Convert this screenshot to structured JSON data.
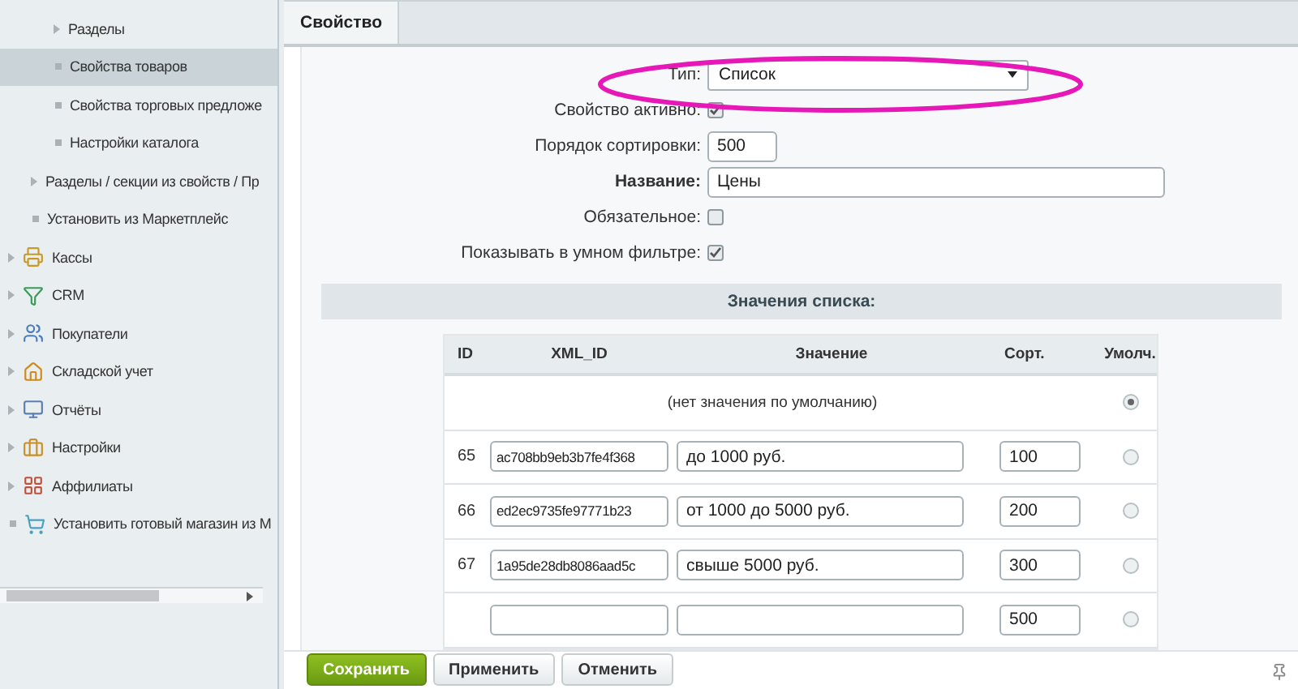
{
  "sidebar": {
    "items": [
      {
        "children": [
          {
            "children": [
              {
                "label": "Разделы",
                "kind": "arrow",
                "selected": false
              },
              {
                "label": "Свойства товаров",
                "kind": "dot",
                "selected": true
              },
              {
                "label": "Свойства торговых предложе",
                "kind": "dot",
                "selected": false
              },
              {
                "label": "Настройки каталога",
                "kind": "dot",
                "selected": false
              }
            ]
          },
          {
            "label": "Разделы / секции из свойств / Пр",
            "kind": "arrow",
            "selected": false
          },
          {
            "label": "Установить из Маркетплейс",
            "kind": "dot",
            "selected": false
          }
        ]
      },
      {
        "label": "Кассы",
        "kind": "arrow",
        "selected": false
      },
      {
        "label": "CRM",
        "kind": "arrow",
        "selected": false
      },
      {
        "label": "Покупатели",
        "kind": "arrow",
        "selected": false
      },
      {
        "label": "Складской учет",
        "kind": "arrow",
        "selected": false
      },
      {
        "label": "Отчёты",
        "kind": "arrow",
        "selected": false
      },
      {
        "label": "Настройки",
        "kind": "arrow",
        "selected": false
      },
      {
        "label": "Аффилиаты",
        "kind": "arrow",
        "selected": false
      },
      {
        "label": "Установить готовый магазин из М",
        "kind": "dot",
        "selected": false
      }
    ]
  },
  "tabs": [
    {
      "label": "Свойство",
      "selected": true
    }
  ],
  "form": {
    "fields": [
      {
        "label": "Тип:",
        "kind": "select",
        "value": "Список",
        "bold": false
      },
      {
        "label": "Свойство активно:",
        "kind": "checkbox",
        "checked": true,
        "bold": false
      },
      {
        "label": "Порядок сортировки:",
        "kind": "short",
        "value": "500",
        "bold": false
      },
      {
        "label": "Название:",
        "kind": "text",
        "value": "Цены",
        "bold": true
      },
      {
        "label": "Обязательное:",
        "kind": "checkbox",
        "checked": false,
        "bold": false
      },
      {
        "label": "Показывать в умном фильтре:",
        "kind": "checkbox",
        "checked": true,
        "bold": false
      }
    ]
  },
  "list_values": {
    "title": "Значения списка:",
    "columns": [
      "ID",
      "XML_ID",
      "Значение",
      "Сорт.",
      "Умолч."
    ],
    "rows": [
      {
        "kind": "no_default",
        "text": "(нет значения по умолчанию)",
        "selected": true
      },
      {
        "kind": "value",
        "id": "65",
        "xml_id": "ac708bb9eb3b7fe4f368",
        "value": "до 1000 руб.",
        "sort": "100",
        "selected": false
      },
      {
        "kind": "value",
        "id": "66",
        "xml_id": "ed2ec9735fe97771b23",
        "value": "от 1000 до 5000 руб.",
        "sort": "200",
        "selected": false
      },
      {
        "kind": "value",
        "id": "67",
        "xml_id": "1a95de28db8086aad5c",
        "value": "свыше 5000 руб.",
        "sort": "300",
        "selected": false
      },
      {
        "kind": "value",
        "sort": "500",
        "selected": false
      }
    ]
  },
  "footer": {
    "buttons": [
      {
        "label": "Сохранить",
        "kind": "primary"
      },
      {
        "label": "Применить",
        "kind": "secondary"
      },
      {
        "label": "Отменить",
        "kind": "secondary"
      }
    ]
  }
}
